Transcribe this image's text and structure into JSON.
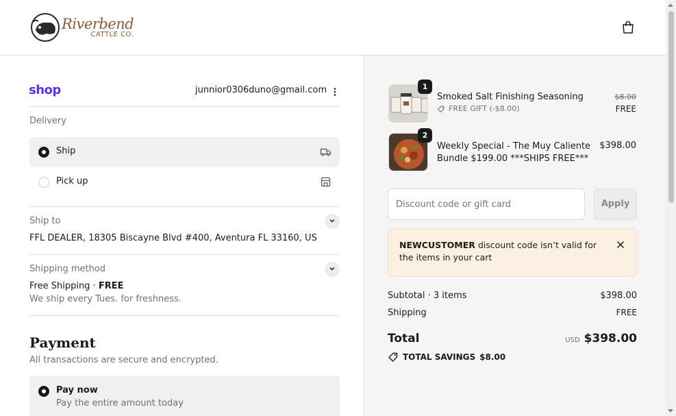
{
  "header": {
    "logo_script": "Riverbend",
    "logo_sub": "CATTLE CO."
  },
  "contact": {
    "shop_label": "shop",
    "email": "junnior0306duno@gmail.com"
  },
  "delivery": {
    "heading": "Delivery",
    "options": [
      {
        "label": "Ship",
        "selected": true,
        "icon": "truck-icon"
      },
      {
        "label": "Pick up",
        "selected": false,
        "icon": "store-icon"
      }
    ]
  },
  "ship_to": {
    "heading": "Ship to",
    "address": "FFL DEALER, 18305 Biscayne Blvd #400, Aventura FL 33160, US"
  },
  "shipping_method": {
    "heading": "Shipping method",
    "name": "Free Shipping · ",
    "price": "FREE",
    "note": "We ship every Tues. for freshness."
  },
  "payment": {
    "title": "Payment",
    "subtitle": "All transactions are secure and encrypted.",
    "option_label": "Pay now",
    "option_desc": "Pay the entire amount today"
  },
  "cart": {
    "items": [
      {
        "qty": "1",
        "name": "Smoked Salt Finishing Seasoning",
        "gift": "FREE GIFT (-$8.00)",
        "original_price": "$8.00",
        "price": "FREE"
      },
      {
        "qty": "2",
        "name_line1": "Weekly Special - The Muy Caliente",
        "name_line2": "Bundle $199.00 ***SHIPS FREE***",
        "price": "$398.00"
      }
    ],
    "discount_placeholder": "Discount code or gift card",
    "apply_label": "Apply",
    "warning_code": "NEWCUSTOMER",
    "warning_msg": " discount code isn’t valid for the items in your cart",
    "subtotal_label": "Subtotal · 3 items",
    "subtotal_value": "$398.00",
    "shipping_label": "Shipping",
    "shipping_value": "FREE",
    "total_label": "Total",
    "currency": "USD",
    "total_value": "$398.00",
    "savings_label": "TOTAL SAVINGS",
    "savings_value": "$8.00"
  },
  "colors": {
    "shop_purple": "#5a31f4",
    "brand_brown": "#8a5a3c",
    "warning_bg": "#fcf0e3"
  }
}
